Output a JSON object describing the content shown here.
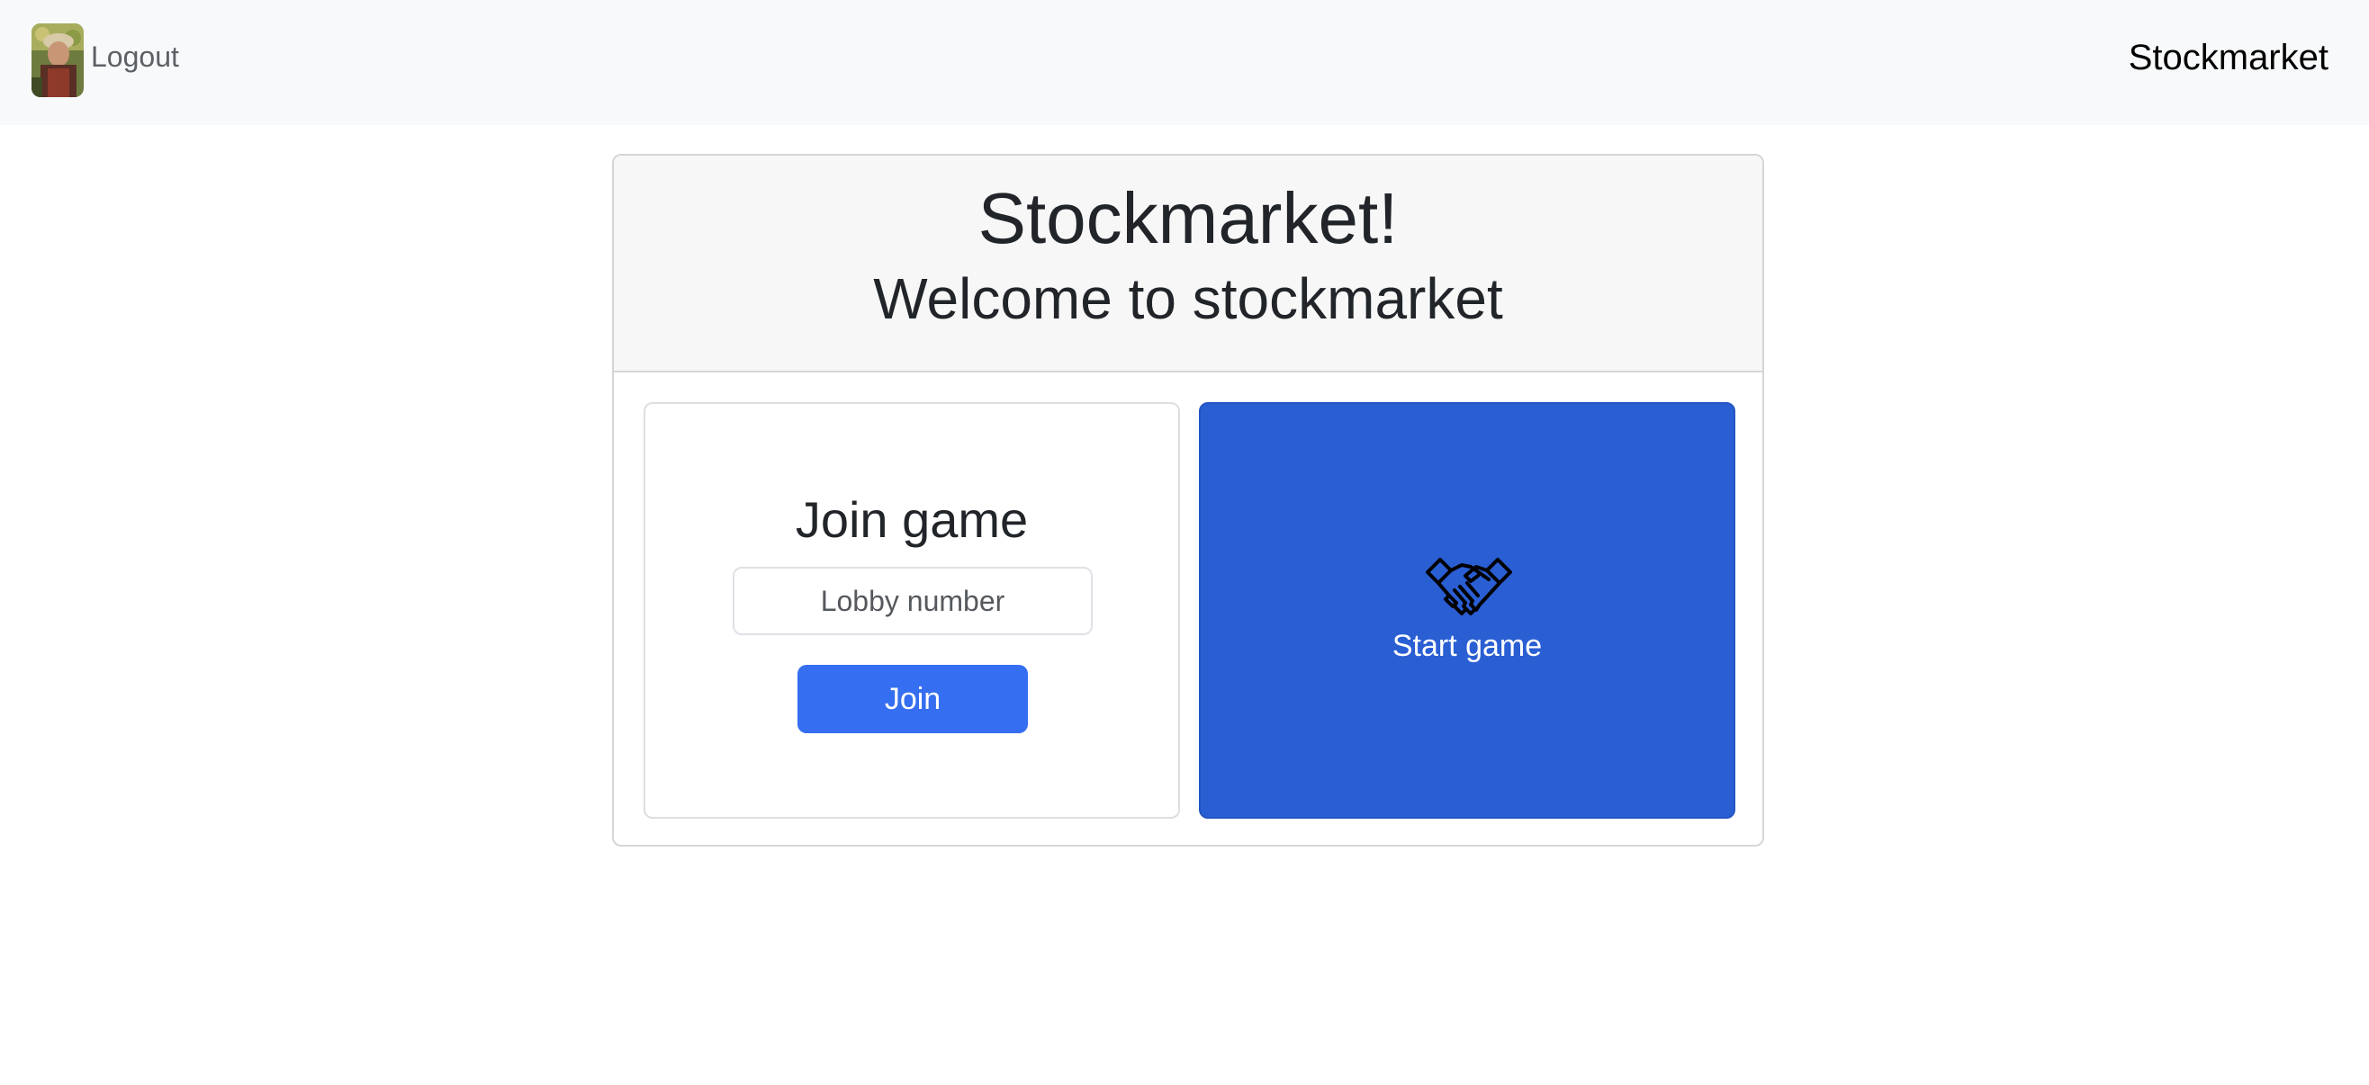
{
  "navbar": {
    "logout_label": "Logout",
    "brand_label": "Stockmarket"
  },
  "card": {
    "title": "Stockmarket!",
    "subtitle": "Welcome to stockmarket"
  },
  "join": {
    "title": "Join game",
    "input_placeholder": "Lobby number",
    "input_value": "",
    "button_label": "Join"
  },
  "start": {
    "icon": "handshake-icon",
    "label": "Start game"
  },
  "colors": {
    "navbar_bg": "#f8f9fa",
    "primary_button": "#356ef0",
    "start_card_bg": "#2a5ed3"
  }
}
